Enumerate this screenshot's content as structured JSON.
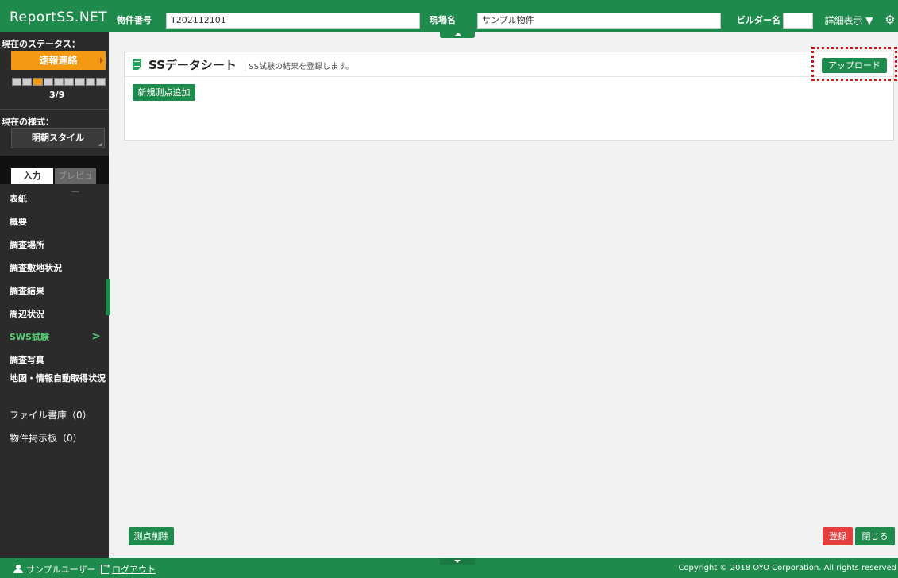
{
  "header": {
    "brand": "ReportSS.NET",
    "property_no_label": "物件番号",
    "property_no_value": "T202112101",
    "site_name_label": "現場名",
    "site_name_value": "サンプル物件",
    "builder_label": "ビルダー名",
    "builder_value": "",
    "detail_label": "詳細表示 ▼"
  },
  "sidebar": {
    "status_label": "現在のステータス：",
    "status_value": "速報連絡",
    "progress": {
      "current": 3,
      "total": 9,
      "text": "3/9"
    },
    "style_label": "現在の様式：",
    "style_value": "明朝スタイル",
    "tabs": {
      "input": "入力",
      "preview": "プレビュー"
    },
    "items": [
      {
        "label": "表紙"
      },
      {
        "label": "概要"
      },
      {
        "label": "調査場所"
      },
      {
        "label": "調査敷地状況"
      },
      {
        "label": "調査結果"
      },
      {
        "label": "周辺状況"
      },
      {
        "label": "SWS試験",
        "chevron": ">"
      },
      {
        "label": "調査写真"
      },
      {
        "label": "地図・情報自動取得状況"
      },
      {
        "label": "ファイル書庫（0）"
      },
      {
        "label": "物件掲示板（0）"
      }
    ]
  },
  "main": {
    "title": "SSデータシート",
    "subtitle": "SS試験の結果を登録します。",
    "upload_label": "アップロード",
    "add_point_label": "新規測点追加"
  },
  "actions": {
    "delete_point_label": "測点削除",
    "register_label": "登録",
    "close_label": "閉じる"
  },
  "footer": {
    "user_name": "サンプルユーザー",
    "logout_label": "ログアウト",
    "copyright": "Copyright © 2018 OYO Corporation. All rights reserved"
  },
  "colors": {
    "primary": "#1e8a4c",
    "status": "#f39a12",
    "danger": "#e53e3e",
    "highlight": "#d0141a"
  }
}
